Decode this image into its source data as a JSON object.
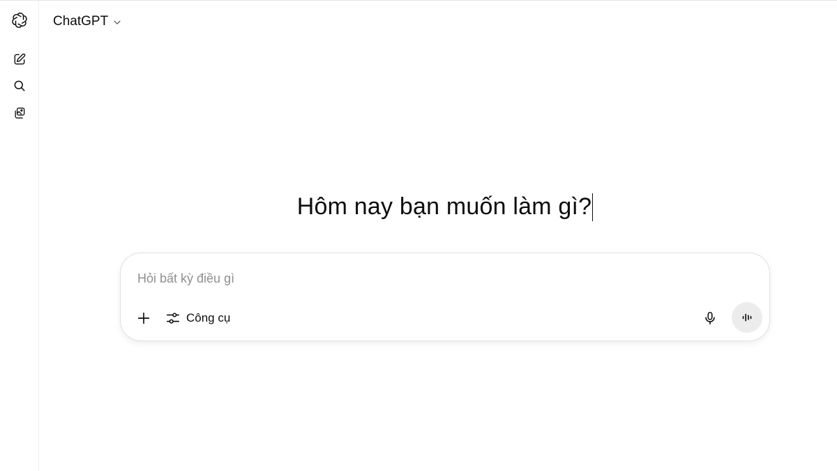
{
  "sidebar": {
    "logo_icon": "openai-logo-icon",
    "items": [
      {
        "icon": "new-chat-icon"
      },
      {
        "icon": "search-icon"
      },
      {
        "icon": "library-icon"
      }
    ]
  },
  "header": {
    "model_name": "ChatGPT",
    "dropdown_icon": "chevron-down-icon"
  },
  "main": {
    "heading": "Hôm nay bạn muốn làm gì?"
  },
  "composer": {
    "placeholder": "Hỏi bất kỳ điều gì",
    "value": "",
    "tools_label": "Công cụ",
    "icons": {
      "attach": "plus-icon",
      "tools": "sliders-icon",
      "mic": "microphone-icon",
      "voice": "voice-waveform-icon"
    }
  },
  "colors": {
    "background": "#ffffff",
    "text": "#0d0d0d",
    "placeholder": "#8f8f8f",
    "voice_button_bg": "#ececec",
    "border": "#e2e2e2"
  }
}
